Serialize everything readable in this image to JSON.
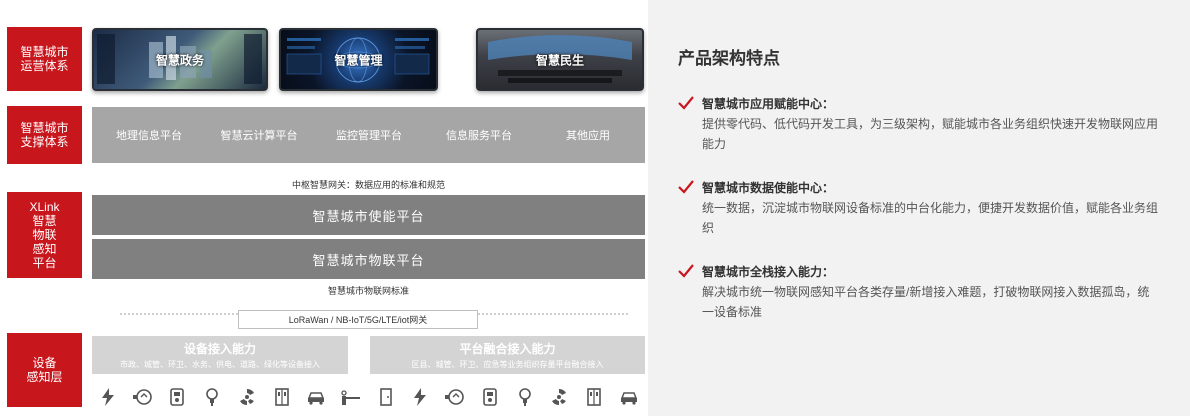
{
  "diagram": {
    "layers": [
      {
        "label": "智慧城市\n运营体系"
      },
      {
        "label": "智慧城市\n支撑体系"
      },
      {
        "label": "XLink\n智慧\n物联\n感知\n平台"
      },
      {
        "label": "设备\n感知层"
      }
    ],
    "screens": [
      "智慧政务",
      "智慧管理",
      "智慧民生"
    ],
    "support_platforms": [
      "地理信息平台",
      "智慧云计算平台",
      "监控管理平台",
      "信息服务平台",
      "其他应用"
    ],
    "gateway_note": "中枢智慧网关：数据应用的标准和规范",
    "enable_platform": "智慧城市使能平台",
    "iot_platform": "智慧城市物联平台",
    "iot_standard": "智慧城市物联网标准",
    "protocols": "LoRaWan / NB-IoT/5G/LTE/iot网关",
    "capabilities": [
      {
        "title": "设备接入能力",
        "sub": "市政、城管、环卫、水务、供电、道路、绿化等设备接入"
      },
      {
        "title": "平台融合接入能力",
        "sub": "区县、城管、环卫、应急等业务组织存量平台融合接入"
      }
    ],
    "device_icons": [
      "lightning-icon",
      "water-meter-icon",
      "parking-meter-icon",
      "bulb-icon",
      "hazard-icon",
      "cabinet-icon",
      "car-icon",
      "barrier-gate-icon",
      "door-icon",
      "lightning-icon",
      "water-meter-icon",
      "parking-meter-icon",
      "bulb-icon",
      "hazard-icon",
      "cabinet-icon",
      "car-icon"
    ]
  },
  "panel": {
    "title": "产品架构特点",
    "features": [
      {
        "title": "智慧城市应用赋能中心：",
        "desc": "提供零代码、低代码开发工具，为三级架构，赋能城市各业务组织快速开发物联网应用能力"
      },
      {
        "title": "智慧城市数据使能中心：",
        "desc": "统一数据，沉淀城市物联网设备标准的中台化能力，便捷开发数据价值，赋能各业务组织"
      },
      {
        "title": "智慧城市全栈接入能力：",
        "desc": "解决城市统一物联网感知平台各类存量/新增接入难题，打破物联网接入数据孤岛，统一设备标准"
      }
    ]
  },
  "colors": {
    "accent_red": "#c8161d",
    "bar_gray": "#808080",
    "box_gray": "#a6a6a6",
    "cap_gray": "#d4d4d4"
  }
}
